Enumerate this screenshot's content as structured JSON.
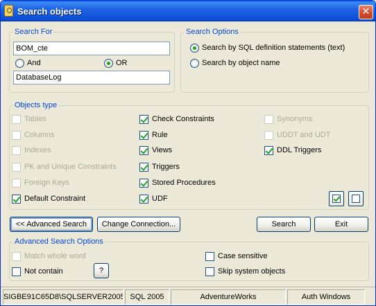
{
  "window": {
    "title": "Search objects",
    "close_symbol": "✕"
  },
  "search_for": {
    "legend": "Search For",
    "first_value": "BOM_cte",
    "and_label": "And",
    "or_label": "OR",
    "or_selected": true,
    "second_value": "DatabaseLog"
  },
  "search_options": {
    "legend": "Search Options",
    "by_sql_label": "Search by SQL definition statements (text)",
    "by_name_label": "Search by object name",
    "selected": "by_sql"
  },
  "objects_type": {
    "legend": "Objects type",
    "tables": "Tables",
    "columns": "Columns",
    "indexes": "Indexes",
    "pk_unique": "PK and Unique Constraints",
    "foreign_keys": "Foreign Keys",
    "default_constraint": "Default Constraint",
    "check_constraints": "Check Constraints",
    "rule": "Rule",
    "views": "Views",
    "triggers": "Triggers",
    "stored_procedures": "Stored Procedures",
    "udf": "UDF",
    "synonyms": "Synonyms",
    "uddt_udt": "UDDT and UDT",
    "ddl_triggers": "DDL Triggers"
  },
  "buttons": {
    "advanced_search": "<< Advanced Search",
    "change_connection": "Change Connection...",
    "search": "Search",
    "exit": "Exit",
    "help": "?"
  },
  "advanced_options": {
    "legend": "Advanced Search Options",
    "match_whole_word": "Match whole word",
    "not_contain": "Not contain",
    "case_sensitive": "Case sensitive",
    "skip_system_objects": "Skip system objects"
  },
  "status": {
    "server": "SIGBE91C65D8\\SQLSERVER2005",
    "version": "SQL 2005",
    "database": "AdventureWorks",
    "auth": "Auth Windows"
  }
}
